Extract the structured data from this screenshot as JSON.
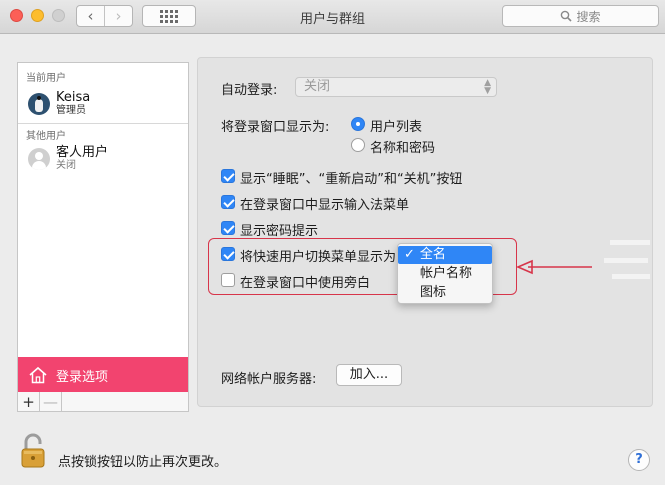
{
  "window": {
    "title": "用户与群组"
  },
  "toolbar": {
    "back_glyph": "‹",
    "forward_glyph": "›",
    "search_placeholder": "搜索",
    "search_icon": "magnifier-icon"
  },
  "sidebar": {
    "current_users_label": "当前用户",
    "current_user": {
      "name": "Keisa",
      "role": "管理员",
      "avatar_icon": "penguin-avatar-icon"
    },
    "other_users_label": "其他用户",
    "guest_user": {
      "name": "客人用户",
      "status": "关闭",
      "avatar_icon": "guest-avatar-icon"
    },
    "login_options_label": "登录选项",
    "add_label": "+",
    "remove_label": "—"
  },
  "login": {
    "auto_login_label": "自动登录:",
    "auto_login_value": "关闭",
    "display_label": "将登录窗口显示为:",
    "display_options": [
      {
        "label": "用户列表",
        "selected": true
      },
      {
        "label": "名称和密码",
        "selected": false
      }
    ],
    "checkboxes": [
      {
        "label": "显示“睡眠”、“重新启动”和“关机”按钮",
        "checked": true
      },
      {
        "label": "在登录窗口中显示输入法菜单",
        "checked": true
      },
      {
        "label": "显示密码提示",
        "checked": true
      },
      {
        "label": "将快速用户切换菜单显示为",
        "checked": true
      },
      {
        "label": "在登录窗口中使用旁白",
        "checked": false
      }
    ],
    "fast_switch_menu": {
      "options": [
        "全名",
        "帐户名称",
        "图标"
      ],
      "selected": "全名",
      "check_glyph": "✓"
    },
    "network_server_label": "网络帐户服务器:",
    "join_button": "加入..."
  },
  "footer": {
    "lock_text": "点按锁按钮以防止再次更改。",
    "help_glyph": "?"
  },
  "colors": {
    "accent": "#2f86f6",
    "sidebar_selected": "#f2446f",
    "annotation": "#d7354a"
  }
}
